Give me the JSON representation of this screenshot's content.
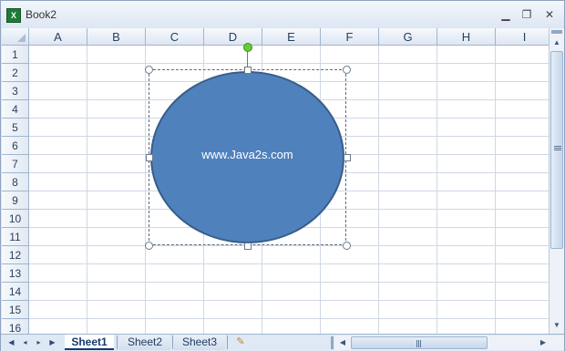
{
  "window": {
    "title": "Book2",
    "app_icon": "excel-icon",
    "controls": {
      "minimize": "▁",
      "restore": "❐",
      "close": "✕"
    }
  },
  "grid": {
    "columns": [
      "A",
      "B",
      "C",
      "D",
      "E",
      "F",
      "G",
      "H",
      "I"
    ],
    "rows": [
      "1",
      "2",
      "3",
      "4",
      "5",
      "6",
      "7",
      "8",
      "9",
      "10",
      "11",
      "12",
      "13",
      "14",
      "15",
      "16"
    ]
  },
  "shape": {
    "text": "www.Java2s.com",
    "fill_color": "#4f81bd",
    "border_color": "#385d8a"
  },
  "sheets": {
    "tabs": [
      "Sheet1",
      "Sheet2",
      "Sheet3"
    ],
    "active": "Sheet1",
    "nav_icons": [
      "first-sheet-icon",
      "prev-sheet-icon",
      "next-sheet-icon",
      "last-sheet-icon"
    ],
    "new_sheet_icon": "insert-sheet-icon"
  },
  "colors": {
    "header_text": "#27415f",
    "gridline": "#d0d7e5",
    "selection_handle_rotate": "#66cc33"
  }
}
